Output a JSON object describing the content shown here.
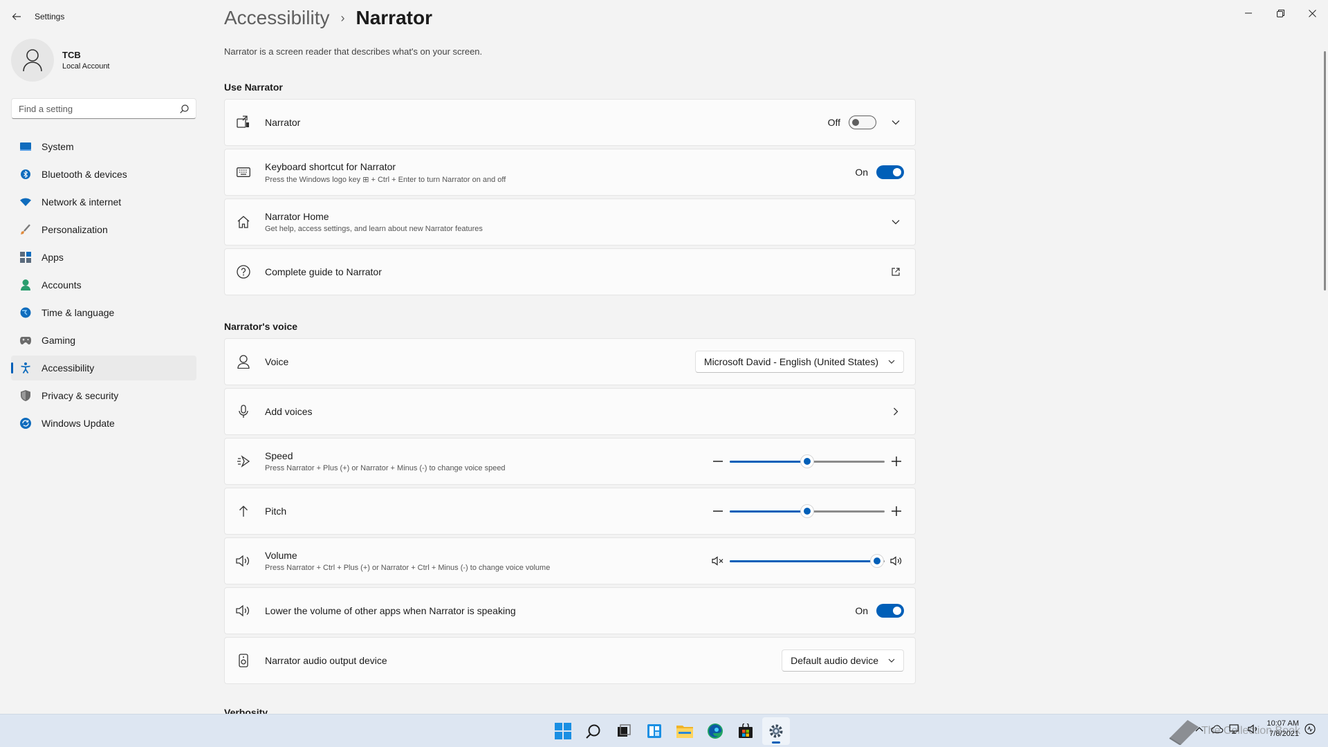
{
  "window": {
    "app_title": "Settings",
    "minimize": "—",
    "maximize": "❐",
    "close": "✕"
  },
  "profile": {
    "name": "TCB",
    "account_type": "Local Account"
  },
  "search": {
    "placeholder": "Find a setting"
  },
  "sidebar": {
    "items": [
      {
        "label": "System",
        "icon": "system-icon",
        "color": "#0f6cbd"
      },
      {
        "label": "Bluetooth & devices",
        "icon": "bluetooth-icon",
        "color": "#0f6cbd"
      },
      {
        "label": "Network & internet",
        "icon": "wifi-icon",
        "color": "#0f6cbd"
      },
      {
        "label": "Personalization",
        "icon": "brush-icon",
        "color": "#e08a3c"
      },
      {
        "label": "Apps",
        "icon": "apps-icon",
        "color": "#5a6b7d"
      },
      {
        "label": "Accounts",
        "icon": "accounts-icon",
        "color": "#2a9d6e"
      },
      {
        "label": "Time & language",
        "icon": "globe-icon",
        "color": "#0f6cbd"
      },
      {
        "label": "Gaming",
        "icon": "gamepad-icon",
        "color": "#6b6b6b"
      },
      {
        "label": "Accessibility",
        "icon": "accessibility-icon",
        "color": "#0f6cbd",
        "active": true
      },
      {
        "label": "Privacy & security",
        "icon": "shield-icon",
        "color": "#6b6b6b"
      },
      {
        "label": "Windows Update",
        "icon": "update-icon",
        "color": "#0f6cbd"
      }
    ]
  },
  "header": {
    "parent": "Accessibility",
    "separator": "›",
    "current": "Narrator",
    "description": "Narrator is a screen reader that describes what's on your screen."
  },
  "sections": {
    "use_narrator": "Use Narrator",
    "narrators_voice": "Narrator's voice",
    "verbosity": "Verbosity"
  },
  "cards": {
    "narrator": {
      "title": "Narrator",
      "state": "Off"
    },
    "shortcut": {
      "title": "Keyboard shortcut for Narrator",
      "subtitle": "Press the Windows logo key ⊞ + Ctrl + Enter to turn Narrator on and off",
      "state": "On"
    },
    "home": {
      "title": "Narrator Home",
      "subtitle": "Get help, access settings, and learn about new Narrator features"
    },
    "guide": {
      "title": "Complete guide to Narrator"
    },
    "voice": {
      "title": "Voice",
      "value": "Microsoft David - English (United States)"
    },
    "add_voices": {
      "title": "Add voices"
    },
    "speed": {
      "title": "Speed",
      "subtitle": "Press Narrator + Plus (+) or Narrator + Minus (-) to change voice speed",
      "level": 0.5
    },
    "pitch": {
      "title": "Pitch",
      "level": 0.5
    },
    "volume": {
      "title": "Volume",
      "subtitle": "Press Narrator + Ctrl + Plus (+) or Narrator + Ctrl + Minus (-) to change voice volume",
      "level": 0.95
    },
    "lower_volume": {
      "title": "Lower the volume of other apps when Narrator is speaking",
      "state": "On"
    },
    "audio_output": {
      "title": "Narrator audio output device",
      "value": "Default audio device"
    }
  },
  "taskbar": {
    "apps": [
      "start-icon",
      "search-icon",
      "task-view-icon",
      "widgets-icon",
      "file-explorer-icon",
      "edge-icon",
      "store-icon",
      "settings-icon"
    ],
    "time": "10:07 AM",
    "date": "7/8/2021",
    "watermark": "The Collection Book"
  },
  "colors": {
    "accent": "#005fb8"
  }
}
